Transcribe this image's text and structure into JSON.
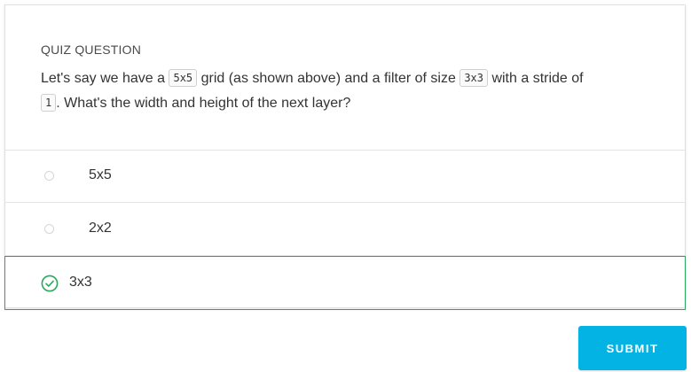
{
  "quiz": {
    "label": "QUIZ QUESTION",
    "question": {
      "part1": "Let's say we have a ",
      "code1": "5x5",
      "part2": " grid (as shown above) and a filter of size ",
      "code2": "3x3",
      "part3": " with a stride of",
      "code3": "1",
      "part4": ". What's the width and height of the next layer?"
    },
    "options": [
      {
        "label": "5x5",
        "selected": false
      },
      {
        "label": "2x2",
        "selected": false
      },
      {
        "label": "3x3",
        "selected": true
      }
    ],
    "submit_label": "SUBMIT"
  },
  "colors": {
    "correct": "#27a85a",
    "submit": "#02b3e4"
  },
  "icons": {
    "selected": "check-circle-icon",
    "unselected": "radio-circle-icon"
  }
}
